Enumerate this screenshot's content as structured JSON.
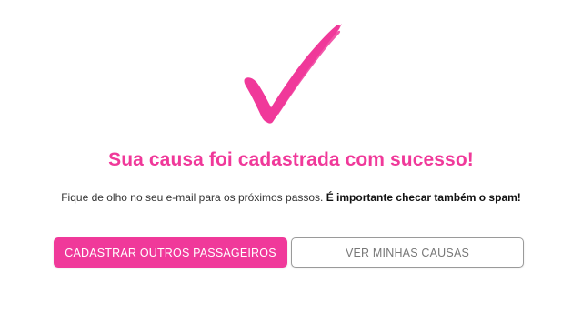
{
  "success": {
    "icon": "brush-checkmark-icon",
    "title": "Sua causa foi cadastrada com sucesso!",
    "message_regular": "Fique de olho no seu e-mail para os próximos passos.",
    "message_bold": "É importante checar também o spam!"
  },
  "actions": {
    "register_more_label": "CADASTRAR OUTROS PASSAGEIROS",
    "view_causes_label": "VER MINHAS CAUSAS"
  },
  "colors": {
    "accent": "#f0399a",
    "text": "#333333",
    "secondary_text": "#777777",
    "border": "#9a9a9a"
  }
}
